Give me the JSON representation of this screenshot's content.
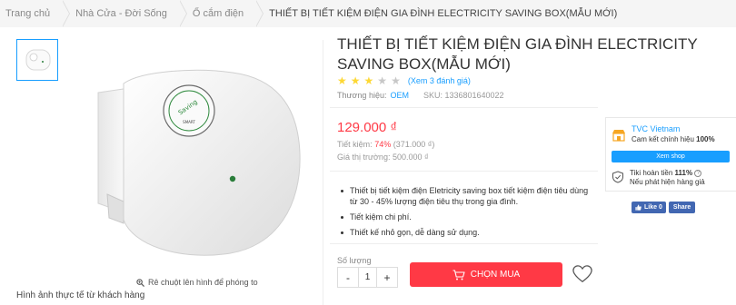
{
  "breadcrumb": [
    "Trang chủ",
    "Nhà Cửa - Đời Sống",
    "Ổ cắm điện",
    "THIẾT BỊ TIẾT KIỆM ĐIỆN GIA ĐÌNH ELECTRICITY SAVING BOX(MẪU MỚI)"
  ],
  "product": {
    "title": "THIẾT BỊ TIẾT KIỆM ĐIỆN GIA ĐÌNH ELECTRICITY SAVING BOX(MẪU MỚI)",
    "rating": 3,
    "rating_max": 5,
    "review_link": "(Xem 3 đánh giá)",
    "brand_label": "Thương hiệu:",
    "brand": "OEM",
    "sku": "SKU: 1336801640022",
    "price": "129.000 ₫",
    "saving_label": "Tiết kiệm:",
    "saving_pct": "74%",
    "saving_amount": "(371.000 ₫)",
    "market_price": "Giá thị trường: 500.000 ₫",
    "bullets": [
      "Thiết bị tiết kiệm điện Eletricity saving box tiết kiệm điện tiêu dùng từ 30 - 45% lượng điện tiêu thụ trong gia đình.",
      "Tiết kiệm chi phí.",
      "Thiết kế nhỏ gọn, dễ dàng sử dụng."
    ],
    "qty_label": "Số lượng",
    "qty_minus": "-",
    "qty": "1",
    "qty_plus": "+",
    "buy_label": "CHỌN MUA"
  },
  "gallery": {
    "zoom_hint": "Rê chuột lên hình để phóng to",
    "real_photo_label": "Hình ảnh thực tế từ khách hàng"
  },
  "seller": {
    "name": "TVC Vietnam",
    "promise_prefix": "Cam kết chính hiệu ",
    "promise_pct": "100%",
    "view_shop": "Xem shop",
    "refund_prefix": "Tiki hoàn tiền ",
    "refund_pct": "111%",
    "refund_suffix": "Nếu phát hiện hàng giả"
  },
  "social": {
    "like": "Like 0",
    "share": "Share"
  },
  "colors": {
    "accent": "#189eff",
    "price": "#ff3945",
    "star": "#fdd835"
  }
}
